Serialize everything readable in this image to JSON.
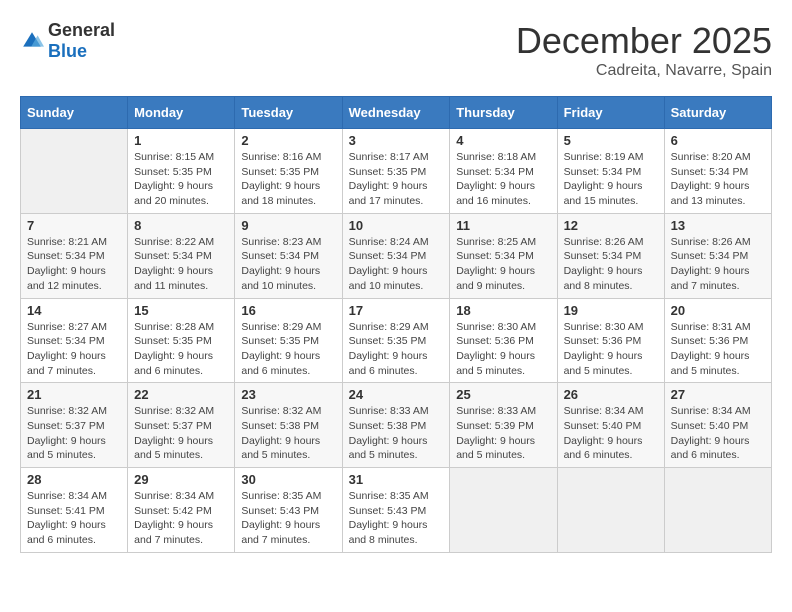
{
  "logo": {
    "general": "General",
    "blue": "Blue"
  },
  "title": "December 2025",
  "location": "Cadreita, Navarre, Spain",
  "days_of_week": [
    "Sunday",
    "Monday",
    "Tuesday",
    "Wednesday",
    "Thursday",
    "Friday",
    "Saturday"
  ],
  "weeks": [
    [
      {
        "day": "",
        "info": ""
      },
      {
        "day": "1",
        "info": "Sunrise: 8:15 AM\nSunset: 5:35 PM\nDaylight: 9 hours\nand 20 minutes."
      },
      {
        "day": "2",
        "info": "Sunrise: 8:16 AM\nSunset: 5:35 PM\nDaylight: 9 hours\nand 18 minutes."
      },
      {
        "day": "3",
        "info": "Sunrise: 8:17 AM\nSunset: 5:35 PM\nDaylight: 9 hours\nand 17 minutes."
      },
      {
        "day": "4",
        "info": "Sunrise: 8:18 AM\nSunset: 5:34 PM\nDaylight: 9 hours\nand 16 minutes."
      },
      {
        "day": "5",
        "info": "Sunrise: 8:19 AM\nSunset: 5:34 PM\nDaylight: 9 hours\nand 15 minutes."
      },
      {
        "day": "6",
        "info": "Sunrise: 8:20 AM\nSunset: 5:34 PM\nDaylight: 9 hours\nand 13 minutes."
      }
    ],
    [
      {
        "day": "7",
        "info": "Sunrise: 8:21 AM\nSunset: 5:34 PM\nDaylight: 9 hours\nand 12 minutes."
      },
      {
        "day": "8",
        "info": "Sunrise: 8:22 AM\nSunset: 5:34 PM\nDaylight: 9 hours\nand 11 minutes."
      },
      {
        "day": "9",
        "info": "Sunrise: 8:23 AM\nSunset: 5:34 PM\nDaylight: 9 hours\nand 10 minutes."
      },
      {
        "day": "10",
        "info": "Sunrise: 8:24 AM\nSunset: 5:34 PM\nDaylight: 9 hours\nand 10 minutes."
      },
      {
        "day": "11",
        "info": "Sunrise: 8:25 AM\nSunset: 5:34 PM\nDaylight: 9 hours\nand 9 minutes."
      },
      {
        "day": "12",
        "info": "Sunrise: 8:26 AM\nSunset: 5:34 PM\nDaylight: 9 hours\nand 8 minutes."
      },
      {
        "day": "13",
        "info": "Sunrise: 8:26 AM\nSunset: 5:34 PM\nDaylight: 9 hours\nand 7 minutes."
      }
    ],
    [
      {
        "day": "14",
        "info": "Sunrise: 8:27 AM\nSunset: 5:34 PM\nDaylight: 9 hours\nand 7 minutes."
      },
      {
        "day": "15",
        "info": "Sunrise: 8:28 AM\nSunset: 5:35 PM\nDaylight: 9 hours\nand 6 minutes."
      },
      {
        "day": "16",
        "info": "Sunrise: 8:29 AM\nSunset: 5:35 PM\nDaylight: 9 hours\nand 6 minutes."
      },
      {
        "day": "17",
        "info": "Sunrise: 8:29 AM\nSunset: 5:35 PM\nDaylight: 9 hours\nand 6 minutes."
      },
      {
        "day": "18",
        "info": "Sunrise: 8:30 AM\nSunset: 5:36 PM\nDaylight: 9 hours\nand 5 minutes."
      },
      {
        "day": "19",
        "info": "Sunrise: 8:30 AM\nSunset: 5:36 PM\nDaylight: 9 hours\nand 5 minutes."
      },
      {
        "day": "20",
        "info": "Sunrise: 8:31 AM\nSunset: 5:36 PM\nDaylight: 9 hours\nand 5 minutes."
      }
    ],
    [
      {
        "day": "21",
        "info": "Sunrise: 8:32 AM\nSunset: 5:37 PM\nDaylight: 9 hours\nand 5 minutes."
      },
      {
        "day": "22",
        "info": "Sunrise: 8:32 AM\nSunset: 5:37 PM\nDaylight: 9 hours\nand 5 minutes."
      },
      {
        "day": "23",
        "info": "Sunrise: 8:32 AM\nSunset: 5:38 PM\nDaylight: 9 hours\nand 5 minutes."
      },
      {
        "day": "24",
        "info": "Sunrise: 8:33 AM\nSunset: 5:38 PM\nDaylight: 9 hours\nand 5 minutes."
      },
      {
        "day": "25",
        "info": "Sunrise: 8:33 AM\nSunset: 5:39 PM\nDaylight: 9 hours\nand 5 minutes."
      },
      {
        "day": "26",
        "info": "Sunrise: 8:34 AM\nSunset: 5:40 PM\nDaylight: 9 hours\nand 6 minutes."
      },
      {
        "day": "27",
        "info": "Sunrise: 8:34 AM\nSunset: 5:40 PM\nDaylight: 9 hours\nand 6 minutes."
      }
    ],
    [
      {
        "day": "28",
        "info": "Sunrise: 8:34 AM\nSunset: 5:41 PM\nDaylight: 9 hours\nand 6 minutes."
      },
      {
        "day": "29",
        "info": "Sunrise: 8:34 AM\nSunset: 5:42 PM\nDaylight: 9 hours\nand 7 minutes."
      },
      {
        "day": "30",
        "info": "Sunrise: 8:35 AM\nSunset: 5:43 PM\nDaylight: 9 hours\nand 7 minutes."
      },
      {
        "day": "31",
        "info": "Sunrise: 8:35 AM\nSunset: 5:43 PM\nDaylight: 9 hours\nand 8 minutes."
      },
      {
        "day": "",
        "info": ""
      },
      {
        "day": "",
        "info": ""
      },
      {
        "day": "",
        "info": ""
      }
    ]
  ]
}
